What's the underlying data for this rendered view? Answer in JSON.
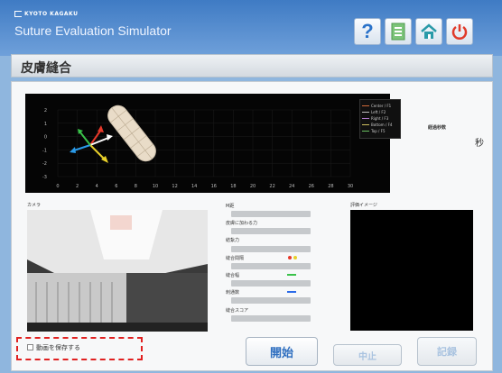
{
  "header": {
    "brand": "KYOTO KAGAKU",
    "app_title": "Suture Evaluation Simulator",
    "buttons": [
      {
        "name": "help",
        "icon": "help-icon",
        "label": "?"
      },
      {
        "name": "document",
        "icon": "document-icon"
      },
      {
        "name": "home",
        "icon": "home-icon"
      },
      {
        "name": "power",
        "icon": "power-icon"
      }
    ]
  },
  "section": {
    "title": "皮膚縫合"
  },
  "trajectory_chart": {
    "x_ticks": [
      "0",
      "2",
      "4",
      "6",
      "8",
      "10",
      "12",
      "14",
      "16",
      "18",
      "20",
      "22",
      "24",
      "26",
      "28",
      "30"
    ],
    "y_ticks": [
      "2",
      "1",
      "0",
      "-1",
      "-2",
      "-3"
    ],
    "legend": [
      {
        "label": "Center / F1",
        "color": "#d06a3a"
      },
      {
        "label": "Left / F2",
        "color": "#bdbdbd"
      },
      {
        "label": "Right / F3",
        "color": "#b07acc"
      },
      {
        "label": "Bottom / F4",
        "color": "#d0c060"
      },
      {
        "label": "Top / F5",
        "color": "#6ac060"
      }
    ]
  },
  "elapsed": {
    "label": "経過秒数",
    "unit": "秒"
  },
  "camera": {
    "label": "カメラ"
  },
  "metrics": [
    {
      "label": "M距"
    },
    {
      "label": "皮膚に加わる力"
    },
    {
      "label": "結紮力"
    },
    {
      "label": "縫合間隔"
    },
    {
      "label": "縫合幅"
    },
    {
      "label": "刺通数"
    },
    {
      "label": "縫合スコア"
    }
  ],
  "evaluation": {
    "label": "評価イメージ"
  },
  "save_video": {
    "label": "動画を保存する",
    "checked": false
  },
  "buttons": {
    "start": "開始",
    "stop": "中止",
    "record": "記録"
  }
}
